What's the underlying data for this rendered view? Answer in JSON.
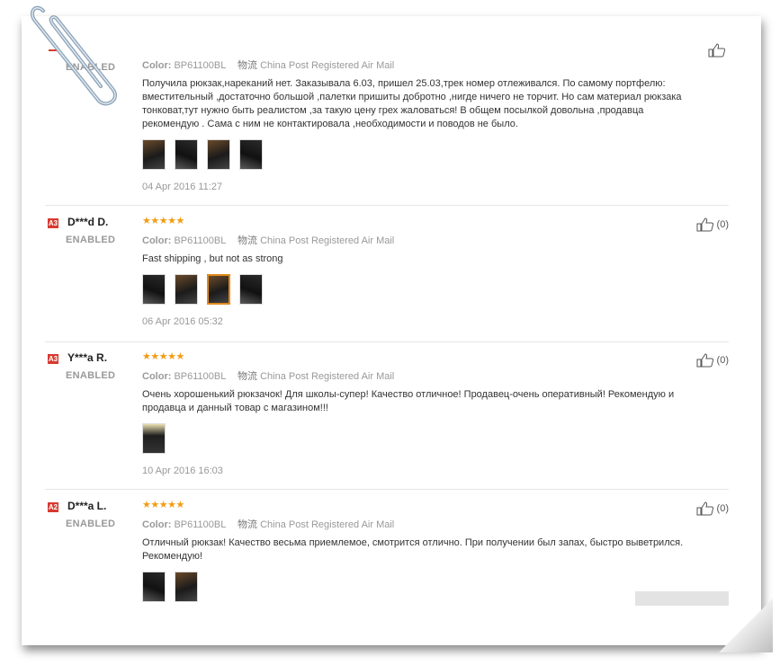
{
  "reviews": [
    {
      "buyer_status": "ENABLED",
      "color_label": "Color:",
      "color_value": "BP61100BL",
      "ship_label": "物流",
      "ship_value": "China Post Registered Air Mail",
      "text": "Получила рюкзак,нареканий нет. Заказывала 6.03, пришел 25.03,трек номер отлеживался. По самому портфелю: вместительный ,достаточно большой ,палетки пришиты добротно ,нигде ничего не торчит. Но сам материал рюкзака тонковат,тут нужно быть реалистом ,за такую цену грех жаловаться! В общем посылкой довольна ,продавца рекомендую . Сама с ним не контактировала ,необходимости и поводов не было.",
      "date": "04 Apr 2016 11:27"
    },
    {
      "flag": "A3",
      "buyer_name": "D***d D.",
      "buyer_status": "ENABLED",
      "stars": "★★★★★",
      "color_label": "Color:",
      "color_value": "BP61100BL",
      "ship_label": "物流",
      "ship_value": "China Post Registered Air Mail",
      "text": "Fast shipping , but not as strong",
      "date": "06 Apr 2016 05:32",
      "helpful": "(0)"
    },
    {
      "flag": "A3",
      "buyer_name": "Y***a R.",
      "buyer_status": "ENABLED",
      "stars": "★★★★★",
      "color_label": "Color:",
      "color_value": "BP61100BL",
      "ship_label": "物流",
      "ship_value": "China Post Registered Air Mail",
      "text": "Очень хорошенький рюкзачок! Для школы-супер! Качество отличное! Продавец-очень оперативный! Рекомендую и продавца и данный товар с магазином!!!",
      "date": "10 Apr 2016 16:03",
      "helpful": "(0)"
    },
    {
      "flag": "A2",
      "buyer_name": "D***a L.",
      "buyer_status": "ENABLED",
      "stars": "★★★★★",
      "color_label": "Color:",
      "color_value": "BP61100BL",
      "ship_label": "物流",
      "ship_value": "China Post Registered Air Mail",
      "text": "Отличный рюкзак! Качество весьма приемлемое, смотрится отлично. При получении был запах, быстро выветрился. Рекомендую!",
      "helpful": "(0)"
    }
  ],
  "colors": {
    "star": "#f39c12",
    "flag": "#d73a2f",
    "accent_border": "#e08a1e"
  }
}
